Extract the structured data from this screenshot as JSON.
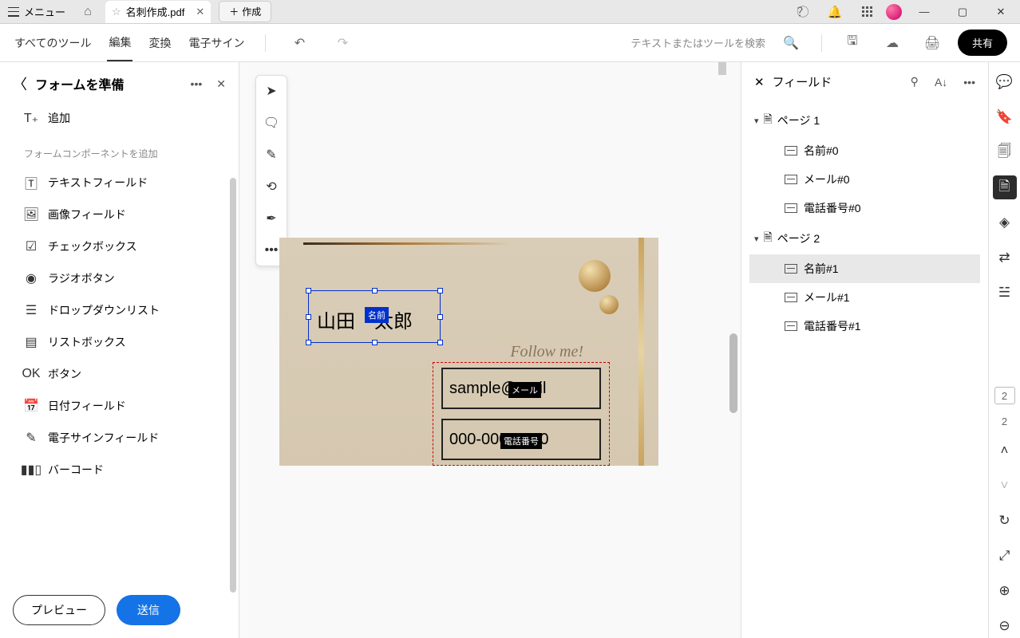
{
  "titlebar": {
    "menu": "メニュー",
    "filename": "名刺作成.pdf",
    "create": "作成"
  },
  "toolbar": {
    "all_tools": "すべてのツール",
    "edit": "編集",
    "convert": "変換",
    "esign": "電子サイン",
    "search_placeholder": "テキストまたはツールを検索",
    "share": "共有"
  },
  "left": {
    "title": "フォームを準備",
    "add": "追加",
    "section": "フォームコンポーネントを追加",
    "items": [
      "テキストフィールド",
      "画像フィールド",
      "チェックボックス",
      "ラジオボタン",
      "ドロップダウンリスト",
      "リストボックス",
      "ボタン",
      "日付フィールド",
      "電子サインフィールド",
      "バーコード"
    ],
    "preview": "プレビュー",
    "submit": "送信"
  },
  "card": {
    "name_value": "山田　太郎",
    "name_label": "名前",
    "email_value": "sample@mail",
    "email_label": "メール",
    "phone_value": "000-0000-000",
    "phone_label": "電話番号",
    "script": "Follow me!"
  },
  "right": {
    "title": "フィールド",
    "pages": [
      {
        "label": "ページ 1",
        "fields": [
          "名前#0",
          "メール#0",
          "電話番号#0"
        ]
      },
      {
        "label": "ページ 2",
        "fields": [
          "名前#1",
          "メール#1",
          "電話番号#1"
        ]
      }
    ],
    "selected": "名前#1"
  },
  "page_indicator": {
    "current": "2",
    "total": "2"
  }
}
